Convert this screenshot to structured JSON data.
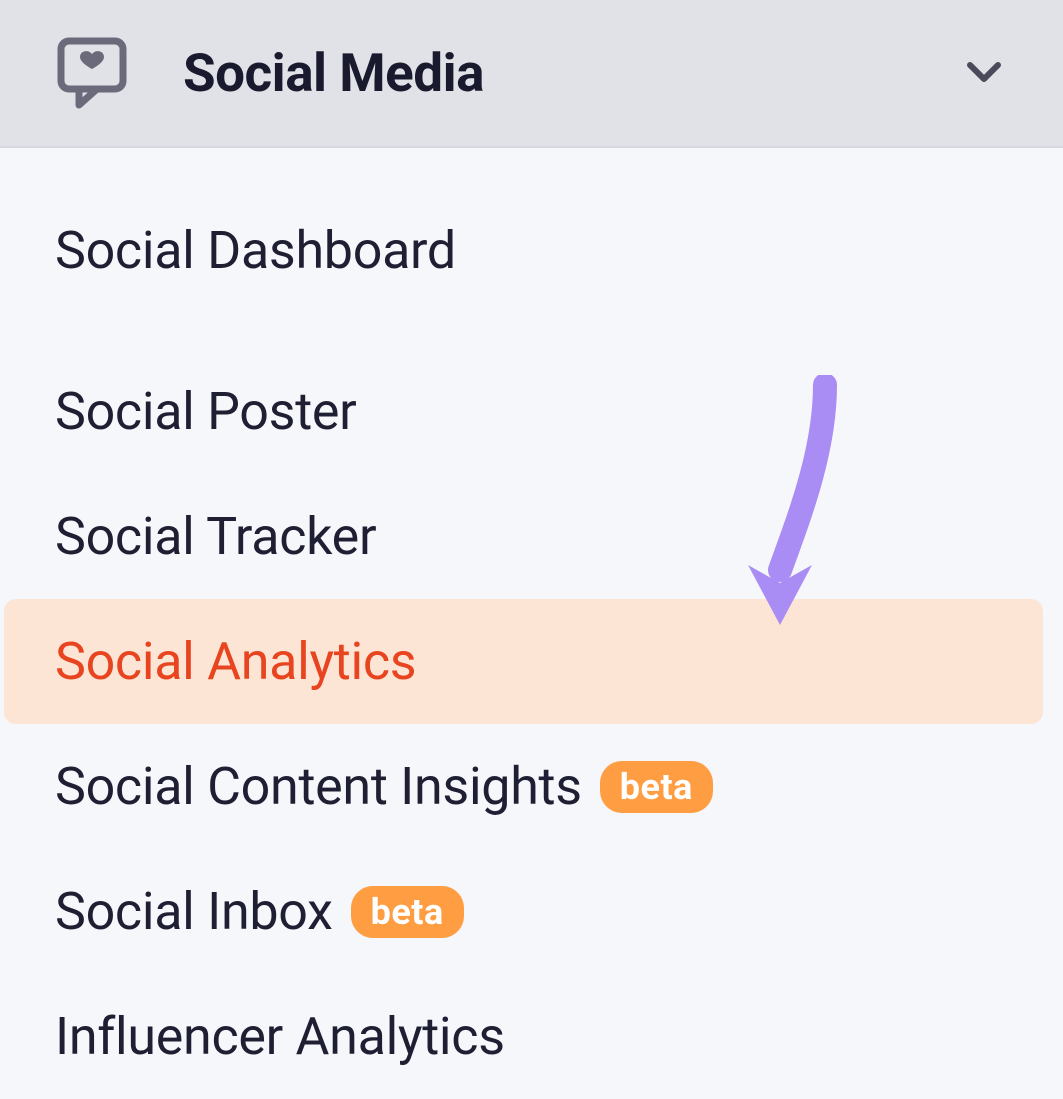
{
  "header": {
    "title": "Social Media"
  },
  "menu": {
    "items": [
      {
        "label": "Social Dashboard",
        "selected": false,
        "badge": null,
        "groupEnd": true
      },
      {
        "label": "Social Poster",
        "selected": false,
        "badge": null,
        "groupEnd": false
      },
      {
        "label": "Social Tracker",
        "selected": false,
        "badge": null,
        "groupEnd": false
      },
      {
        "label": "Social Analytics",
        "selected": true,
        "badge": null,
        "groupEnd": false
      },
      {
        "label": "Social Content Insights",
        "selected": false,
        "badge": "beta",
        "groupEnd": false
      },
      {
        "label": "Social Inbox",
        "selected": false,
        "badge": "beta",
        "groupEnd": false
      },
      {
        "label": "Influencer Analytics",
        "selected": false,
        "badge": null,
        "groupEnd": false
      }
    ]
  },
  "annotation": {
    "arrow_color": "#a98cf4"
  }
}
